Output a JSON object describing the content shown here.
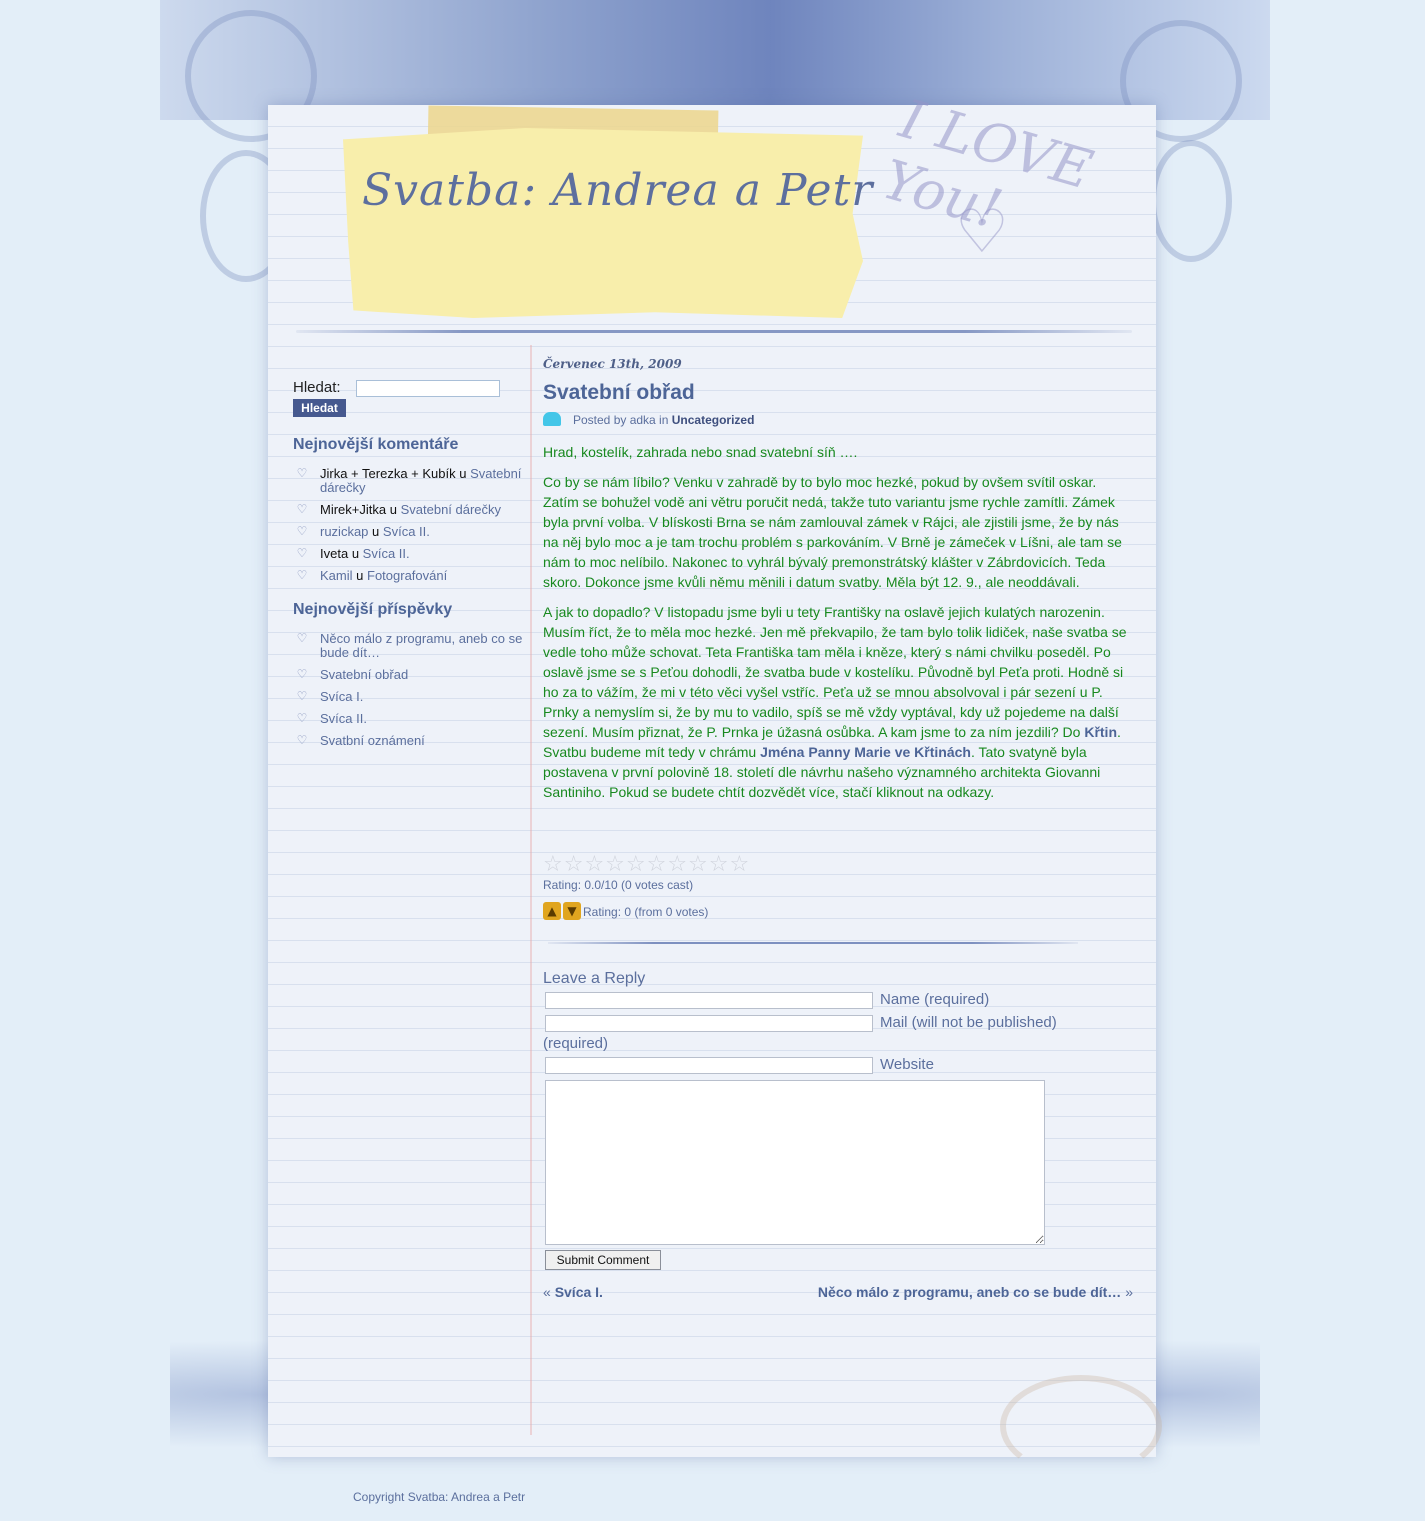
{
  "site": {
    "title": "Svatba: Andrea a Petr",
    "header_art_text": "I LOVE You!"
  },
  "search": {
    "label": "Hledat:",
    "button": "Hledat",
    "value": ""
  },
  "recent_comments": {
    "title": "Nejnovější komentáře",
    "items": [
      {
        "author": "Jirka + Terezka + Kubík",
        "sep": "u",
        "post": "Svatební dárečky"
      },
      {
        "author": "Mirek+Jitka",
        "sep": "u",
        "post": "Svatební dárečky"
      },
      {
        "author": "ruzickap",
        "sep": "u",
        "post": "Svíca II."
      },
      {
        "author": "Iveta",
        "sep": "u",
        "post": "Svíca II."
      },
      {
        "author": "Kamil",
        "sep": "u",
        "post": "Fotografování"
      }
    ]
  },
  "recent_posts": {
    "title": "Nejnovější příspěvky",
    "items": [
      "Něco málo z programu, aneb co se bude dít…",
      "Svatební obřad",
      "Svíca I.",
      "Svíca II.",
      "Svatbní oznámení"
    ]
  },
  "post": {
    "date": "Červenec 13th, 2009",
    "title": "Svatební obřad",
    "meta_prefix": "Posted by adka in",
    "category": "Uncategorized",
    "p1": "Hrad, kostelík, zahrada nebo snad svatební síň ….",
    "p2": "Co by se nám líbilo? Venku v zahradě by to bylo moc hezké, pokud by ovšem svítil oskar. Zatím se bohužel vodě ani větru poručit nedá, takže tuto variantu jsme rychle zamítli. Zámek byla první volba. V blískosti Brna se nám zamlouval zámek v Rájci, ale zjistili jsme, že by nás na něj bylo moc a je tam trochu problém s parkováním. V Brně je zámeček v Líšni, ale tam se nám to moc nelíbilo. Nakonec to vyhrál bývalý premonstrátský klášter v Zábrdovicích. Teda skoro. Dokonce jsme kvůli němu měnili i datum svatby. Měla být 12. 9., ale neoddávali.",
    "p3_part1": "A jak to dopadlo? V listopadu jsme byli u tety Františky na oslavě jejich kulatých narozenin. Musím říct, že to měla moc hezké.  Jen mě překvapilo, že tam bylo tolik lidiček, naše svatba se vedle toho může schovat. Teta Františka tam měla i kněze, který s námi chvilku poseděl. Po oslavě jsme se s Peťou dohodli, že svatba bude v kostelíku. Původně byl Peťa proti. Hodně si ho za to vážím, že mi v této věci vyšel vstříc. Peťa už se mnou absolvoval i pár sezení u P. Prnky a nemyslím si, že by mu to vadilo, spíš se mě vždy vyptával, kdy už pojedeme na další sezení. Musím přiznat, že P. Prnka je úžasná osůbka. A kam jsme to za ním jezdili? Do ",
    "p3_link1": "Křtin",
    "p3_part2": ". Svatbu budeme mít tedy v chrámu ",
    "p3_link2": "Jména Panny Marie ve Křtinách",
    "p3_part3": ". Tato svatyně byla postavena v první polovině 18. století dle návrhu našeho významného architekta Giovanni Santiniho. Pokud se budete chtít dozvědět více, stačí kliknout na odkazy."
  },
  "rating": {
    "stars_text": "☆☆☆☆☆☆☆☆☆☆",
    "stars_value": 0.0,
    "stars_max": 10,
    "line1": "Rating: 0.0/10 (0 votes cast)",
    "line2": "Rating: 0 (from 0 votes)"
  },
  "reply": {
    "title": "Leave a Reply",
    "name_label": "Name (required)",
    "mail_label": "Mail (will not be published)",
    "mail_label2": "(required)",
    "website_label": "Website",
    "submit": "Submit Comment"
  },
  "nav": {
    "prev_arrow": "«",
    "prev": "Svíca I.",
    "next": "Něco málo z programu, aneb co se bude dít…",
    "next_arrow": "»"
  },
  "footer": {
    "copyright": "Copyright Svatba: Andrea a Petr"
  },
  "icons": {
    "bullet": "heart-icon",
    "author": "user-icon",
    "thumb_up": "thumbs-up-icon",
    "thumb_down": "thumbs-down-icon"
  }
}
